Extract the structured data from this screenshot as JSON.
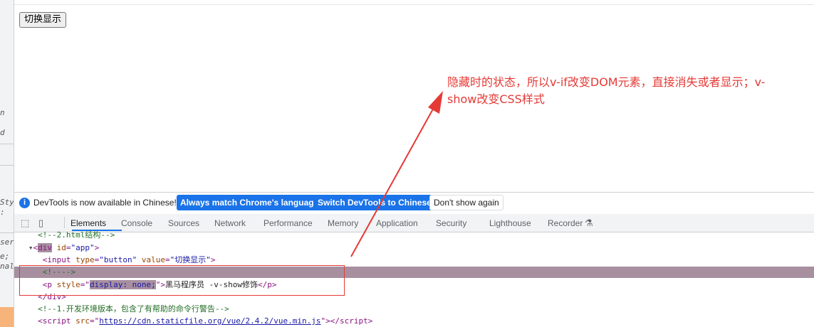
{
  "left_strip": {
    "fragments": [
      "n",
      "d",
      "Sty",
      ":",
      "ser",
      "e;",
      "nal"
    ]
  },
  "page": {
    "toggle_button": "切换显示"
  },
  "annotation": {
    "text": "隐藏时的状态，所以v-if改变DOM元素，直接消失或者显示；v-show改变CSS样式",
    "color": "#e53935"
  },
  "devtools": {
    "notice": {
      "message": "DevTools is now available in Chinese!",
      "match_button": "Always match Chrome's language",
      "switch_button": "Switch DevTools to Chinese",
      "dismiss_button": "Don't show again"
    },
    "tabs": [
      "Elements",
      "Console",
      "Sources",
      "Network",
      "Performance",
      "Memory",
      "Application",
      "Security",
      "Lighthouse",
      "Recorder"
    ],
    "active_tab": "Elements",
    "code": {
      "l1_comment": "<!--2.html结构-->",
      "l2_tag": "div",
      "l2_attr": "id",
      "l2_val": "\"app\"",
      "l3_tag": "input",
      "l3_attr1": "type",
      "l3_val1": "\"button\"",
      "l3_attr2": "value",
      "l3_val2": "\"切换显示\"",
      "l4_comment": "<!---->",
      "l5_tag": "p",
      "l5_attr": "style",
      "l5_val": "display: none;",
      "l5_text": "黑马程序员 -v-show修饰",
      "l6_close": "</div>",
      "l7_comment": "<!--1.开发环境版本，包含了有帮助的命令行警告-->",
      "l8_tag": "script",
      "l8_attr": "src",
      "l8_link": "https://cdn.staticfile.org/vue/2.4.2/vue.min.js"
    }
  }
}
